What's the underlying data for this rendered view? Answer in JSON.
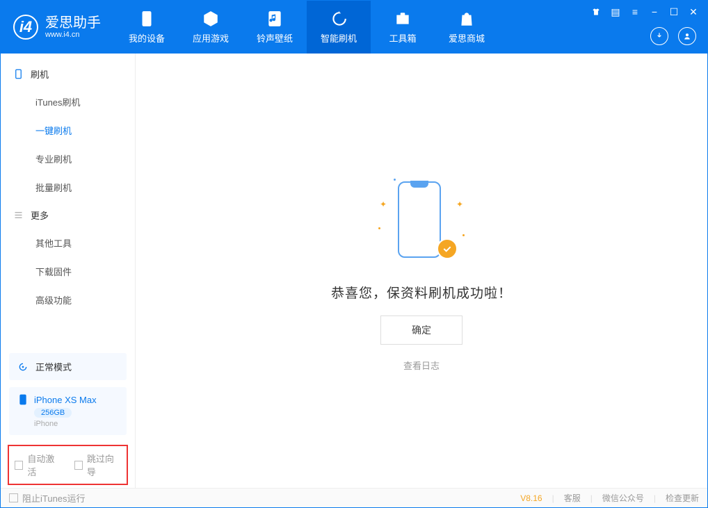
{
  "app": {
    "title": "爱思助手",
    "subtitle": "www.i4.cn"
  },
  "tabs": [
    {
      "label": "我的设备"
    },
    {
      "label": "应用游戏"
    },
    {
      "label": "铃声壁纸"
    },
    {
      "label": "智能刷机"
    },
    {
      "label": "工具箱"
    },
    {
      "label": "爱思商城"
    }
  ],
  "sidebar": {
    "group1": {
      "title": "刷机",
      "items": [
        "iTunes刷机",
        "一键刷机",
        "专业刷机",
        "批量刷机"
      ],
      "active_index": 1
    },
    "group2": {
      "title": "更多",
      "items": [
        "其他工具",
        "下载固件",
        "高级功能"
      ]
    }
  },
  "device_mode_card": {
    "label": "正常模式"
  },
  "device_info": {
    "name": "iPhone XS Max",
    "storage": "256GB",
    "type": "iPhone"
  },
  "checkboxes": {
    "auto_activate": "自动激活",
    "skip_guide": "跳过向导"
  },
  "main": {
    "success_text": "恭喜您，保资料刷机成功啦！",
    "ok_button": "确定",
    "log_link": "查看日志"
  },
  "footer": {
    "block_itunes": "阻止iTunes运行",
    "version": "V8.16",
    "links": [
      "客服",
      "微信公众号",
      "检查更新"
    ]
  }
}
